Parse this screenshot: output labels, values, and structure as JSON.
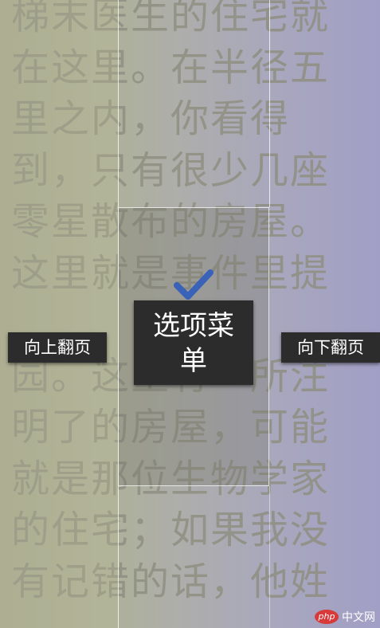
{
  "book": {
    "lines": [
      "梯末医生的住宅就",
      "在这里。在半径五",
      "里之内，你看得",
      "到，只有很少几座",
      "零星散布的房屋。",
      "这里就是事件里提",
      "",
      "园。这里有一所注",
      "明了的房屋，可能",
      "就是那位生物学家",
      "的住宅；如果我没",
      "有记错的话，他姓"
    ]
  },
  "controls": {
    "prev_page": "向上翻页",
    "next_page": "向下翻页",
    "menu": "选项菜单"
  },
  "watermark": {
    "logo": "php",
    "text": "中文网"
  },
  "colors": {
    "check": "#3a62b8",
    "button_bg": "#2c2c2c",
    "watermark_logo": "#d83a3a"
  }
}
